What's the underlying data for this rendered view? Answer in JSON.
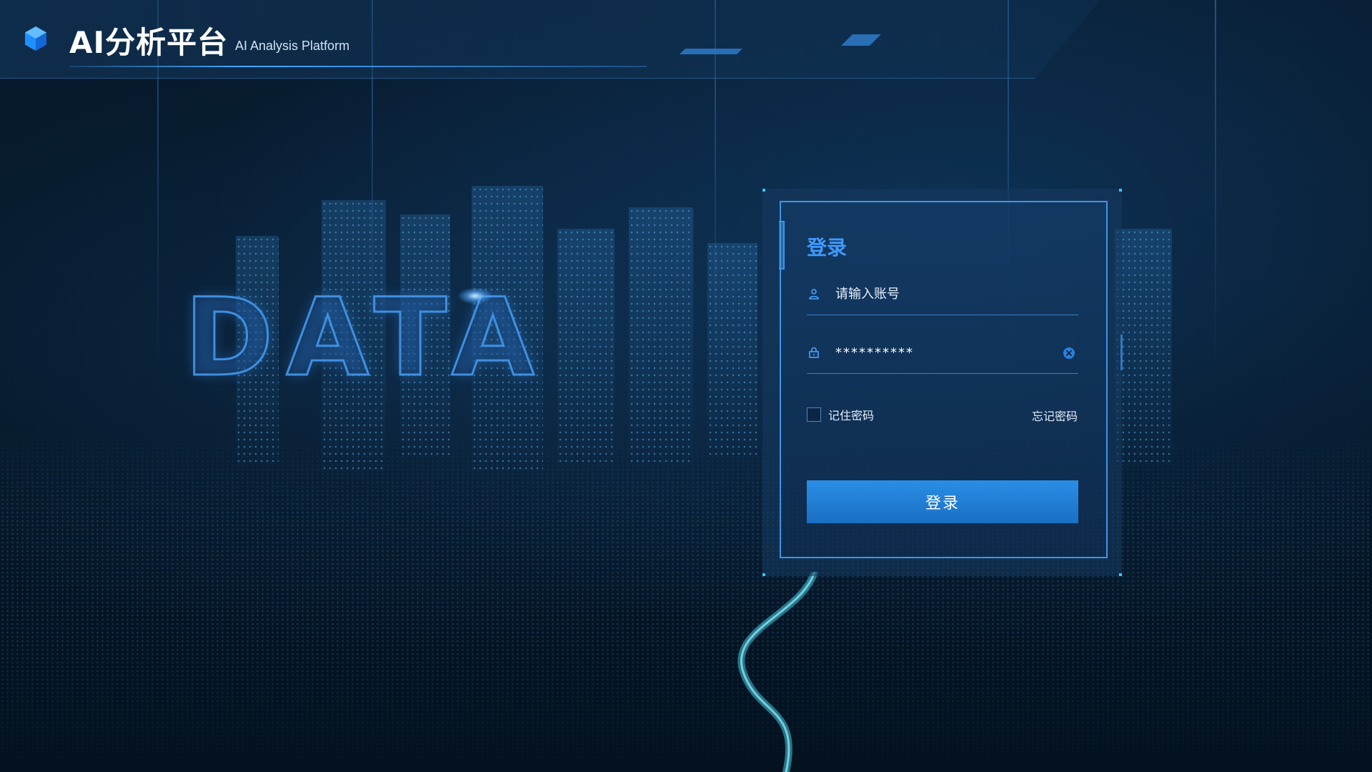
{
  "header": {
    "title": "AI分析平台",
    "subtitle": "AI Analysis Platform"
  },
  "hero": {
    "text": "DATA"
  },
  "login": {
    "title": "登录",
    "username": {
      "placeholder": "请输入账号",
      "value": "",
      "icon": "user-icon"
    },
    "password": {
      "placeholder": "",
      "value": "**********",
      "icon": "lock-icon",
      "clear_icon": "clear-icon"
    },
    "remember_label": "记住密码",
    "remember_checked": false,
    "forgot_label": "忘记密码",
    "submit_label": "登录"
  },
  "colors": {
    "accent": "#3f9bff",
    "panel_border": "#3f94e8",
    "button": "#2a8ee6",
    "background": "#071a2d"
  }
}
